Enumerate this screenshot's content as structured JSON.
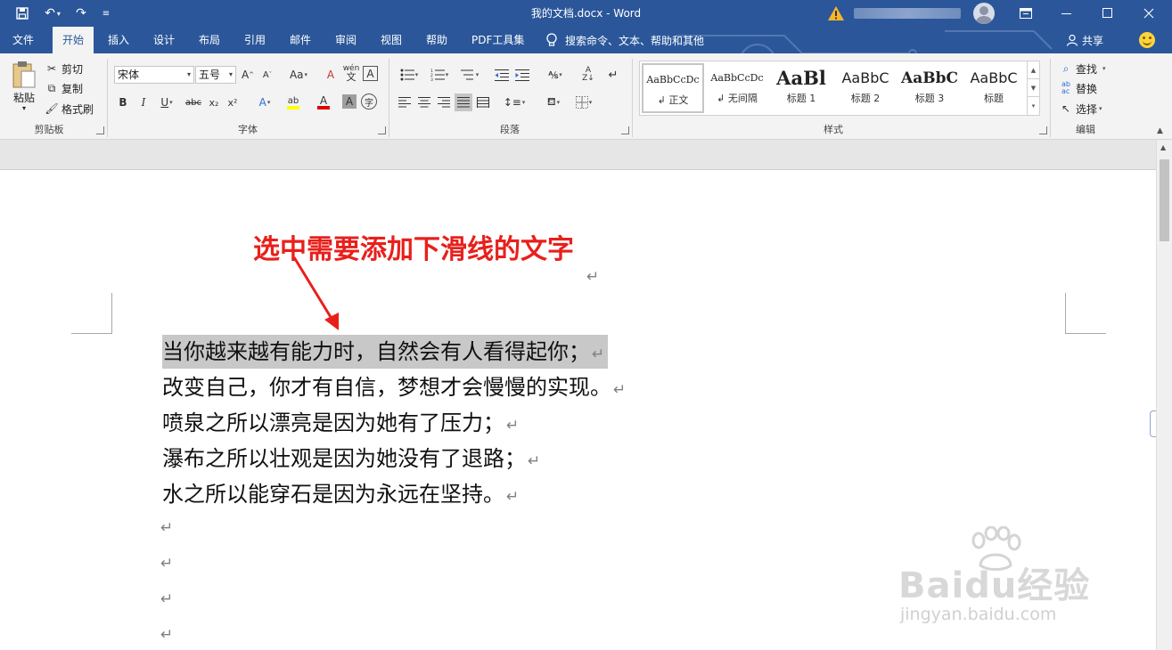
{
  "window": {
    "title": "我的文档.docx  -  Word",
    "controls": {
      "ribbon_display": "▭",
      "minimize": "—",
      "maximize": "☐",
      "close": "✕"
    }
  },
  "quick_access": {
    "save": "save-icon",
    "undo": "undo-icon",
    "redo": "redo-icon",
    "customize": "customize-icon"
  },
  "tabs": [
    {
      "label": "文件"
    },
    {
      "label": "开始",
      "active": true
    },
    {
      "label": "插入"
    },
    {
      "label": "设计"
    },
    {
      "label": "布局"
    },
    {
      "label": "引用"
    },
    {
      "label": "邮件"
    },
    {
      "label": "审阅"
    },
    {
      "label": "视图"
    },
    {
      "label": "帮助"
    },
    {
      "label": "PDF工具集"
    }
  ],
  "tell_me": "搜索命令、文本、帮助和其他",
  "share_label": "共享",
  "ribbon": {
    "clipboard": {
      "label": "剪贴板",
      "paste": "粘贴",
      "cut": "剪切",
      "copy": "复制",
      "format_painter": "格式刷"
    },
    "font": {
      "label": "字体",
      "font_name": "宋体",
      "font_size": "五号",
      "grow": "A",
      "shrink": "A",
      "case": "Aa",
      "clear": "A",
      "phonetic": "wén",
      "border": "A",
      "bold": "B",
      "italic": "I",
      "underline": "U",
      "strike": "abc",
      "sub": "x₂",
      "sup": "x²",
      "effects": "A",
      "highlight": "ab",
      "color": "A",
      "shading": "A",
      "enclose": "字"
    },
    "paragraph": {
      "label": "段落"
    },
    "styles": {
      "label": "样式",
      "items": [
        {
          "preview": "AaBbCcDc",
          "name": "↲ 正文"
        },
        {
          "preview": "AaBbCcDc",
          "name": "↲ 无间隔"
        },
        {
          "preview": "AaBl",
          "name": "标题 1"
        },
        {
          "preview": "AaBbC",
          "name": "标题 2"
        },
        {
          "preview": "AaBbC",
          "name": "标题 3"
        },
        {
          "preview": "AaBbC",
          "name": "标题"
        }
      ]
    },
    "editing": {
      "label": "编辑",
      "find": "查找",
      "replace": "替换",
      "select": "选择"
    }
  },
  "document": {
    "annotation": "选中需要添加下滑线的文字",
    "return_mark": "↵",
    "lines": [
      "当你越来越有能力时，自然会有人看得起你；",
      "改变自己，你才有自信，梦想才会慢慢的实现。",
      "喷泉之所以漂亮是因为她有了压力；",
      "瀑布之所以壮观是因为她没有了退路；",
      "水之所以能穿石是因为永远在坚持。"
    ],
    "highlighted_line": 0
  },
  "watermark": {
    "logo": "Baidu经验",
    "url": "jingyan.baidu.com"
  },
  "colors": {
    "title_bar": "#2b579a",
    "ribbon_bg": "#f3f3f3",
    "annotation": "#e8201c",
    "selection": "#c8c8c8"
  }
}
